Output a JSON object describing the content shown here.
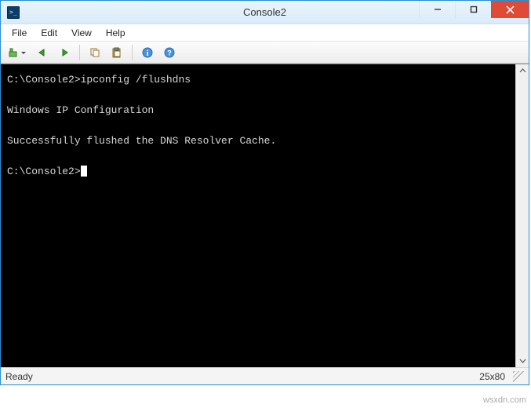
{
  "window": {
    "title": "Console2"
  },
  "menu": {
    "file": "File",
    "edit": "Edit",
    "view": "View",
    "help": "Help"
  },
  "toolbar": {
    "newtab_icon": "new-tab-icon",
    "prev_icon": "prev-arrow-icon",
    "next_icon": "next-arrow-icon",
    "copy_icon": "copy-icon",
    "paste_icon": "paste-icon",
    "info_icon": "info-icon",
    "help_icon": "help-icon"
  },
  "terminal": {
    "prompt": "C:\\Console2>",
    "command": "ipconfig /flushdns",
    "lines": [
      "Windows IP Configuration",
      "Successfully flushed the DNS Resolver Cache."
    ]
  },
  "status": {
    "ready": "Ready",
    "dimensions": "25x80"
  },
  "watermark": "wsxdn.com"
}
